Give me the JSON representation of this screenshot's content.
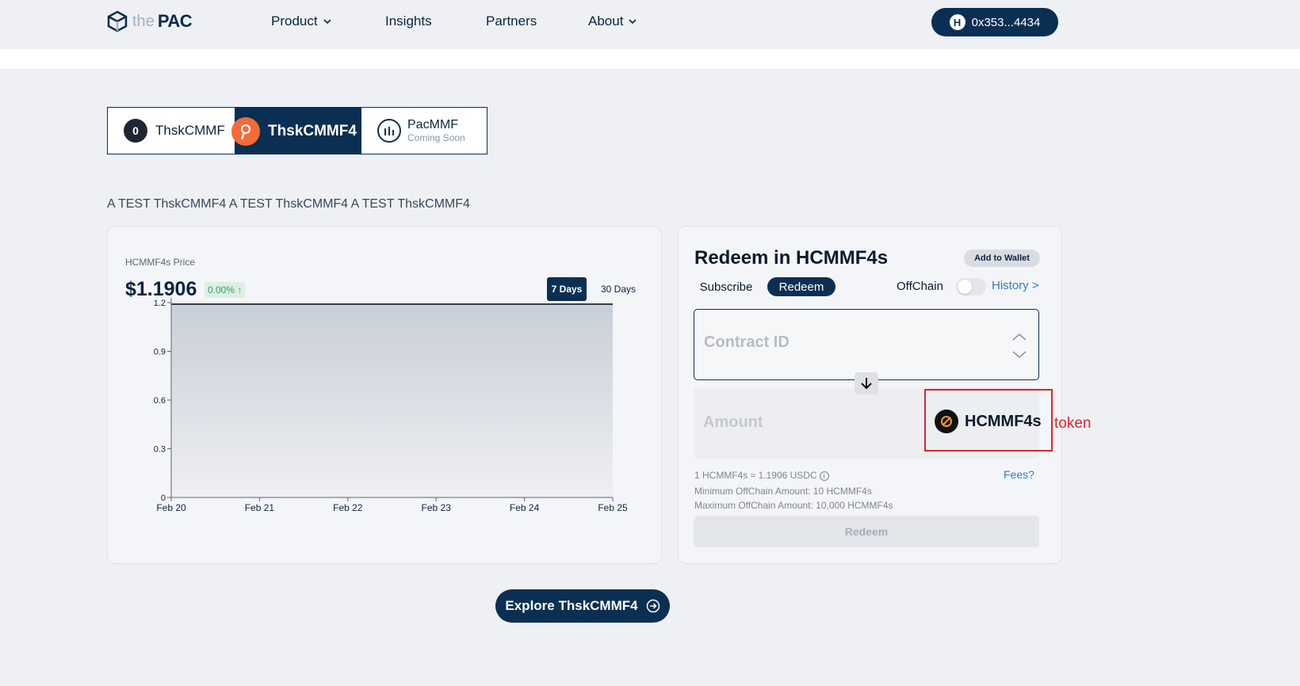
{
  "header": {
    "logo_prefix": "the",
    "logo_name": "PAC",
    "nav": [
      {
        "label": "Product",
        "dropdown": true
      },
      {
        "label": "Insights",
        "dropdown": false
      },
      {
        "label": "Partners",
        "dropdown": false
      },
      {
        "label": "About",
        "dropdown": true
      }
    ],
    "wallet_icon_letter": "H",
    "wallet_address": "0x353...4434"
  },
  "fund_tabs": [
    {
      "label": "ThskCMMF",
      "icon": "fund-logo-icon",
      "active": false
    },
    {
      "label": "ThskCMMF4",
      "icon": "pin-logo-icon",
      "active": true
    },
    {
      "label": "PacMMF",
      "sublabel": "Coming Soon",
      "icon": "pacmmf-logo-icon",
      "active": false
    }
  ],
  "description": "A TEST ThskCMMF4 A TEST ThskCMMF4 A TEST ThskCMMF4",
  "price_panel": {
    "label": "HCMMF4s Price",
    "value": "$1.1906",
    "change": "0.00% ↑",
    "ranges": [
      "7 Days",
      "30 Days"
    ],
    "selected_range": "7 Days"
  },
  "chart_data": {
    "type": "area",
    "title": "",
    "xlabel": "",
    "ylabel": "",
    "x": [
      "Feb 20",
      "Feb 21",
      "Feb 22",
      "Feb 23",
      "Feb 24",
      "Feb 25"
    ],
    "y_ticks": [
      "0",
      "0.3",
      "0.6",
      "0.9",
      "1.2"
    ],
    "ylim": [
      0,
      1.2
    ],
    "series": [
      {
        "values": [
          1.1906,
          1.1906,
          1.1906,
          1.1906,
          1.1906,
          1.1906
        ]
      }
    ],
    "grid": false,
    "colors": {
      "line": "#0b1a2e",
      "fill_top": "#c9cfd8",
      "fill_bottom": "#eef0f3"
    }
  },
  "redeem": {
    "title": "Redeem in HCMMF4s",
    "add_to_wallet": "Add to Wallet",
    "mode_subscribe": "Subscribe",
    "mode_redeem": "Redeem",
    "offchain_label": "OffChain",
    "offchain_enabled": false,
    "history_link": "History >",
    "contract_placeholder": "Contract ID",
    "amount_placeholder": "Amount",
    "token_name": "HCMMF4s",
    "rate_note": "1 HCMMF4s ≈ 1.1906 USDC",
    "fees_link": "Fees?",
    "min_note": "Minimum OffChain Amount: 10 HCMMF4s",
    "max_note": "Maximum OffChain Amount: 10,000 HCMMF4s",
    "submit_label": "Redeem"
  },
  "annotation_label": "token",
  "explore_button": "Explore ThskCMMF4",
  "colors": {
    "primary": "#0b2f52",
    "link": "#2e7bd1",
    "annotation": "#e0242b",
    "accent_orange": "#f26b38"
  }
}
